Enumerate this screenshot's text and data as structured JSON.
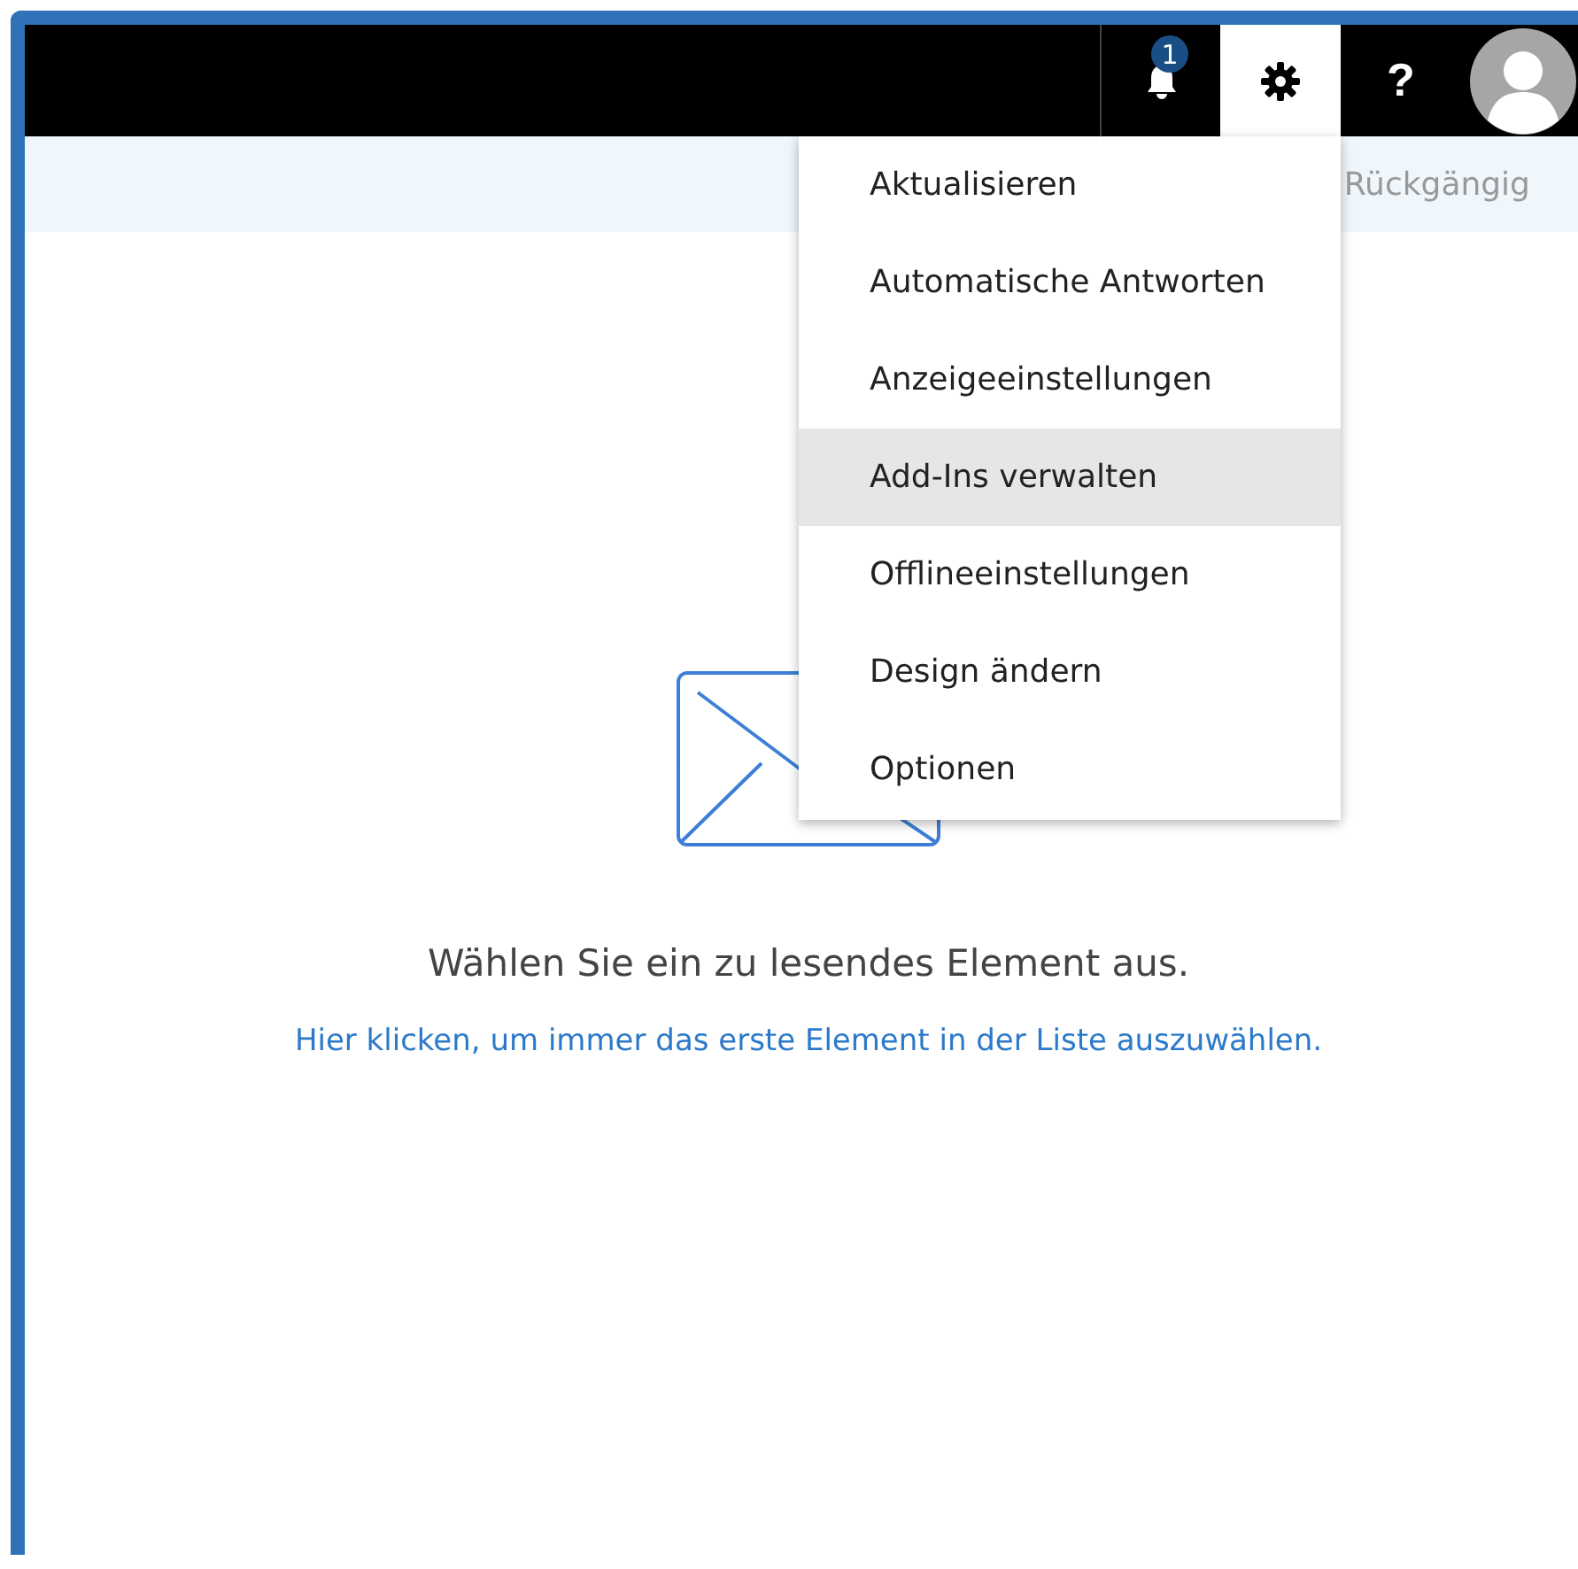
{
  "header": {
    "buttons": [
      {
        "kind": "bell",
        "badge": "1",
        "selected": false
      },
      {
        "kind": "gear",
        "selected": true
      },
      {
        "kind": "help",
        "label": "?",
        "selected": false
      },
      {
        "kind": "avatar",
        "selected": false
      }
    ]
  },
  "command_bar": {
    "undo": "Rückgängig"
  },
  "settings_menu": {
    "items": [
      {
        "label": "Aktualisieren",
        "selected": false
      },
      {
        "label": "Automatische Antworten",
        "selected": false
      },
      {
        "label": "Anzeigeeinstellungen",
        "selected": false
      },
      {
        "label": "Add-Ins verwalten",
        "selected": true
      },
      {
        "label": "Offlineeinstellungen",
        "selected": false
      },
      {
        "label": "Design ändern",
        "selected": false
      },
      {
        "label": "Optionen",
        "selected": false
      }
    ]
  },
  "reading_pane": {
    "message": "Wählen Sie ein zu lesendes Element aus.",
    "link": "Hier klicken, um immer das erste Element in der Liste auszuwählen."
  }
}
